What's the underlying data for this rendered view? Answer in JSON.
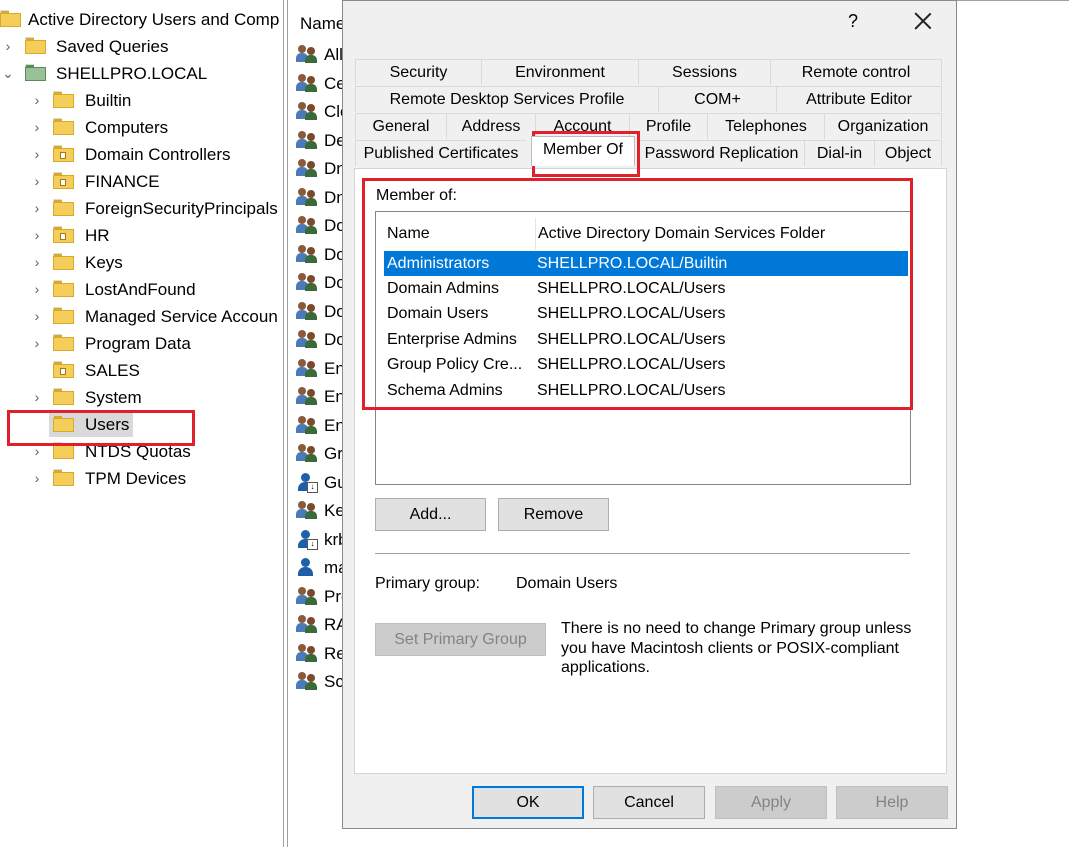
{
  "tree": {
    "root_title": "Active Directory Users and Comp",
    "items": [
      {
        "label": "Saved Queries"
      },
      {
        "label": "SHELLPRO.LOCAL"
      },
      {
        "label": "Builtin"
      },
      {
        "label": "Computers"
      },
      {
        "label": "Domain Controllers"
      },
      {
        "label": "FINANCE"
      },
      {
        "label": "ForeignSecurityPrincipals"
      },
      {
        "label": "HR"
      },
      {
        "label": "Keys"
      },
      {
        "label": "LostAndFound"
      },
      {
        "label": "Managed Service Accoun"
      },
      {
        "label": "Program Data"
      },
      {
        "label": "SALES"
      },
      {
        "label": "System"
      },
      {
        "label": "Users"
      },
      {
        "label": "NTDS Quotas"
      },
      {
        "label": "TPM Devices"
      }
    ]
  },
  "list": {
    "header": "Name",
    "rows": [
      "All",
      "Ce",
      "Clo",
      "De",
      "Dn",
      "Dn",
      "Do",
      "Do",
      "Do",
      "Do",
      "Do",
      "En",
      "En",
      "En",
      "Gr",
      "Gu",
      "Ke",
      "krb",
      "ma",
      "Pro",
      "RA",
      "Re",
      "Sch"
    ]
  },
  "dialog": {
    "help": "?",
    "tabs_row1": [
      "Security",
      "Environment",
      "Sessions",
      "Remote control"
    ],
    "tabs_row2": [
      "Remote Desktop Services Profile",
      "COM+",
      "Attribute Editor"
    ],
    "tabs_row3": [
      "General",
      "Address",
      "Account",
      "Profile",
      "Telephones",
      "Organization"
    ],
    "tabs_row4": [
      "Published Certificates",
      "Member Of",
      "Password Replication",
      "Dial-in",
      "Object"
    ],
    "member_of_label": "Member of:",
    "columns": [
      "Name",
      "Active Directory Domain Services Folder"
    ],
    "members": [
      {
        "name": "Administrators",
        "folder": "SHELLPRO.LOCAL/Builtin"
      },
      {
        "name": "Domain Admins",
        "folder": "SHELLPRO.LOCAL/Users"
      },
      {
        "name": "Domain Users",
        "folder": "SHELLPRO.LOCAL/Users"
      },
      {
        "name": "Enterprise Admins",
        "folder": "SHELLPRO.LOCAL/Users"
      },
      {
        "name": "Group Policy Cre...",
        "folder": "SHELLPRO.LOCAL/Users"
      },
      {
        "name": "Schema Admins",
        "folder": "SHELLPRO.LOCAL/Users"
      }
    ],
    "add_label": "Add...",
    "remove_label": "Remove",
    "primary_group_label": "Primary group:",
    "primary_group_value": "Domain Users",
    "set_primary_label": "Set Primary Group",
    "note": "There is no need to change Primary group unless you have Macintosh clients or POSIX-compliant applications.",
    "ok_label": "OK",
    "cancel_label": "Cancel",
    "apply_label": "Apply",
    "help_label": "Help"
  }
}
